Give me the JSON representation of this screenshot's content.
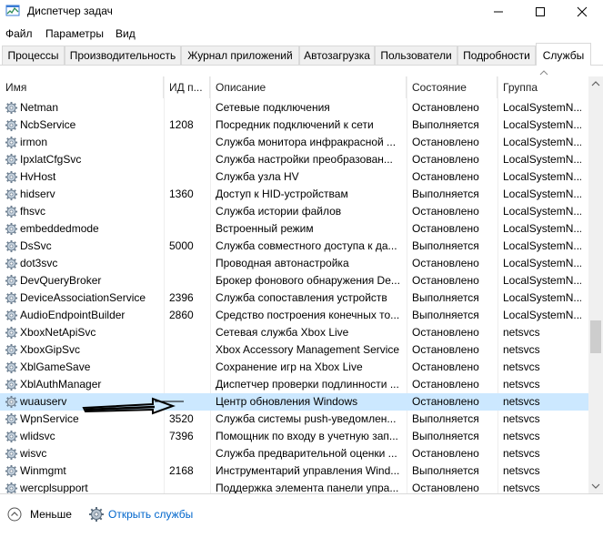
{
  "window": {
    "title": "Диспетчер задач"
  },
  "menu": [
    "Файл",
    "Параметры",
    "Вид"
  ],
  "tabs": [
    "Процессы",
    "Производительность",
    "Журнал приложений",
    "Автозагрузка",
    "Пользователи",
    "Подробности",
    "Службы"
  ],
  "active_tab": "Службы",
  "columns": {
    "name": "Имя",
    "pid": "ИД п...",
    "desc": "Описание",
    "status": "Состояние",
    "group": "Группа"
  },
  "rows": [
    {
      "name": "Netman",
      "pid": "",
      "desc": "Сетевые подключения",
      "status": "Остановлено",
      "group": "LocalSystemN..."
    },
    {
      "name": "NcbService",
      "pid": "1208",
      "desc": "Посредник подключений к сети",
      "status": "Выполняется",
      "group": "LocalSystemN..."
    },
    {
      "name": "irmon",
      "pid": "",
      "desc": "Служба монитора инфракрасной ...",
      "status": "Остановлено",
      "group": "LocalSystemN..."
    },
    {
      "name": "IpxlatCfgSvc",
      "pid": "",
      "desc": "Служба настройки преобразован...",
      "status": "Остановлено",
      "group": "LocalSystemN..."
    },
    {
      "name": "HvHost",
      "pid": "",
      "desc": "Служба узла HV",
      "status": "Остановлено",
      "group": "LocalSystemN..."
    },
    {
      "name": "hidserv",
      "pid": "1360",
      "desc": "Доступ к HID-устройствам",
      "status": "Выполняется",
      "group": "LocalSystemN..."
    },
    {
      "name": "fhsvc",
      "pid": "",
      "desc": "Служба истории файлов",
      "status": "Остановлено",
      "group": "LocalSystemN..."
    },
    {
      "name": "embeddedmode",
      "pid": "",
      "desc": "Встроенный режим",
      "status": "Остановлено",
      "group": "LocalSystemN..."
    },
    {
      "name": "DsSvc",
      "pid": "5000",
      "desc": "Служба совместного доступа к да...",
      "status": "Выполняется",
      "group": "LocalSystemN..."
    },
    {
      "name": "dot3svc",
      "pid": "",
      "desc": "Проводная автонастройка",
      "status": "Остановлено",
      "group": "LocalSystemN..."
    },
    {
      "name": "DevQueryBroker",
      "pid": "",
      "desc": "Брокер фонового обнаружения De...",
      "status": "Остановлено",
      "group": "LocalSystemN..."
    },
    {
      "name": "DeviceAssociationService",
      "pid": "2396",
      "desc": "Служба сопоставления устройств",
      "status": "Выполняется",
      "group": "LocalSystemN..."
    },
    {
      "name": "AudioEndpointBuilder",
      "pid": "2860",
      "desc": "Средство построения конечных то...",
      "status": "Выполняется",
      "group": "LocalSystemN..."
    },
    {
      "name": "XboxNetApiSvc",
      "pid": "",
      "desc": "Сетевая служба Xbox Live",
      "status": "Остановлено",
      "group": "netsvcs"
    },
    {
      "name": "XboxGipSvc",
      "pid": "",
      "desc": "Xbox Accessory Management Service",
      "status": "Остановлено",
      "group": "netsvcs"
    },
    {
      "name": "XblGameSave",
      "pid": "",
      "desc": "Сохранение игр на Xbox Live",
      "status": "Остановлено",
      "group": "netsvcs"
    },
    {
      "name": "XblAuthManager",
      "pid": "",
      "desc": "Диспетчер проверки подлинности ...",
      "status": "Остановлено",
      "group": "netsvcs"
    },
    {
      "name": "wuauserv",
      "pid": "",
      "desc": "Центр обновления Windows",
      "status": "Остановлено",
      "group": "netsvcs"
    },
    {
      "name": "WpnService",
      "pid": "3520",
      "desc": "Служба системы push-уведомлен...",
      "status": "Выполняется",
      "group": "netsvcs"
    },
    {
      "name": "wlidsvc",
      "pid": "7396",
      "desc": "Помощник по входу в учетную зап...",
      "status": "Выполняется",
      "group": "netsvcs"
    },
    {
      "name": "wisvc",
      "pid": "",
      "desc": "Служба предварительной оценки ...",
      "status": "Остановлено",
      "group": "netsvcs"
    },
    {
      "name": "Winmgmt",
      "pid": "2168",
      "desc": "Инструментарий управления Wind...",
      "status": "Выполняется",
      "group": "netsvcs"
    },
    {
      "name": "wercplsupport",
      "pid": "",
      "desc": "Поддержка элемента панели упра...",
      "status": "Остановлено",
      "group": "netsvcs"
    }
  ],
  "selected_row": "wuauserv",
  "footer": {
    "less": "Меньше",
    "open_services": "Открыть службы"
  },
  "colors": {
    "selection": "#cce8ff",
    "link": "#0066cc"
  }
}
